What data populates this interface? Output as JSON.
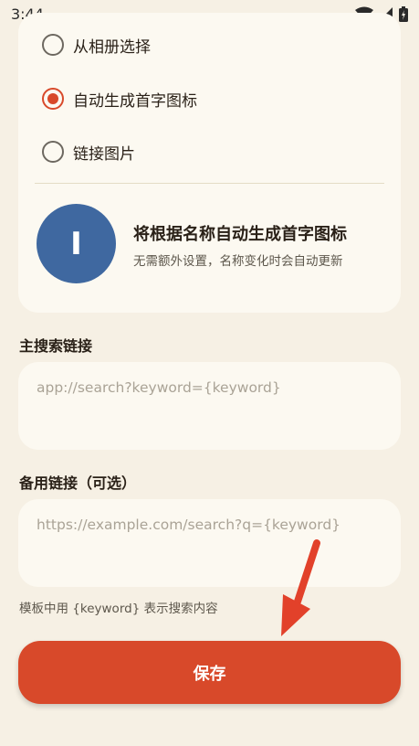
{
  "status_bar": {
    "time": "3:44"
  },
  "icon_source": {
    "options": [
      {
        "label": "从相册选择",
        "selected": false
      },
      {
        "label": "自动生成首字图标",
        "selected": true
      },
      {
        "label": "链接图片",
        "selected": false
      }
    ]
  },
  "preview": {
    "letter": "I",
    "avatar_color": "#3f68a0",
    "title": "将根据名称自动生成首字图标",
    "subtitle": "无需额外设置，名称变化时会自动更新"
  },
  "main_search": {
    "label": "主搜索链接",
    "value": "",
    "placeholder": "app://search?keyword={keyword}"
  },
  "backup_search": {
    "label": "备用链接（可选）",
    "value": "",
    "placeholder": "https://example.com/search?q={keyword}"
  },
  "hint": "模板中用 {keyword} 表示搜索内容",
  "save_button": {
    "label": "保存",
    "color": "#d8492a"
  },
  "colors": {
    "accent": "#d8492a",
    "background": "#f6f0e4",
    "card": "#fcf9f1"
  },
  "icons": [
    "wifi-icon",
    "signal-icon",
    "battery-icon",
    "annotation-arrow-icon"
  ]
}
